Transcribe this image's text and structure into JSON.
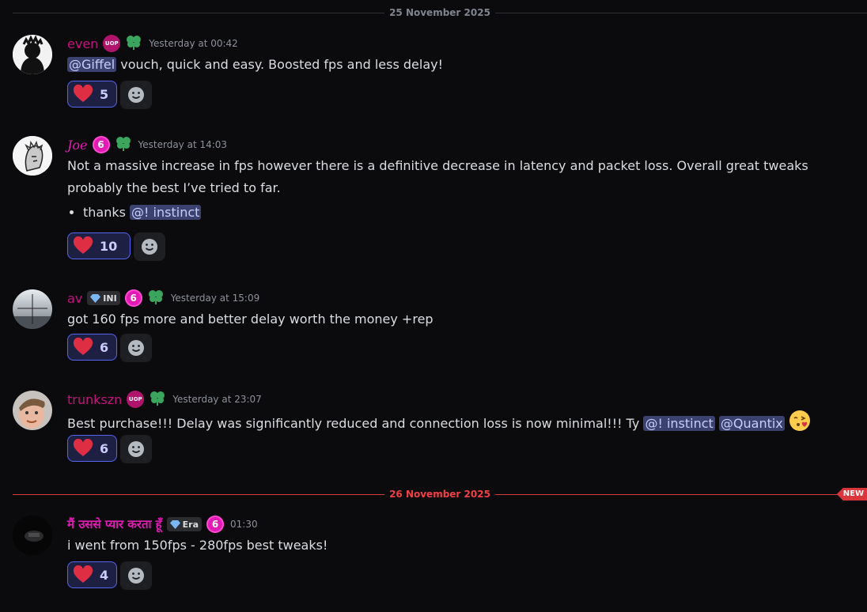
{
  "dividers": {
    "first": "25 November 2025",
    "second": "26 November 2025",
    "new_label": "NEW"
  },
  "colors": {
    "pink_name": "#c2127c",
    "magenta_name": "#e21bb5",
    "mention_bg": "#3c4270",
    "reaction_border": "#5865f2",
    "new_red": "#da373c"
  },
  "messages": [
    {
      "username": "even",
      "timestamp": "Yesterday at 00:42",
      "mention": "@Giffel",
      "text": " vouch, quick and easy. Boosted fps and less delay!",
      "reaction_count": "5"
    },
    {
      "username": "Joe",
      "timestamp": "Yesterday at 14:03",
      "text": "Not a massive increase in fps however there is a definitive decrease in latency and packet loss. Overall great tweaks probably the best I’ve tried to far.",
      "bullet_text": "thanks ",
      "bullet_mention": "@! instinct",
      "reaction_count": "10"
    },
    {
      "username": "av",
      "tag": "INI",
      "timestamp": "Yesterday at 15:09",
      "text": "got 160 fps more and better delay worth the money +rep",
      "reaction_count": "6"
    },
    {
      "username": "trunkszn",
      "timestamp": "Yesterday at 23:07",
      "text": "Best purchase!!! Delay was significantly reduced and connection loss is now minimal!!! Ty ",
      "mention1": "@! instinct",
      "mention2": "@Quantix",
      "reaction_count": "6"
    },
    {
      "username": "मैं उससे प्यार करता हूँ",
      "tag": "Era",
      "timestamp": "01:30",
      "text": "i went from 150fps - 280fps best tweaks!",
      "reaction_count": "4"
    }
  ],
  "badges": {
    "uop": "UOP",
    "six": "6"
  },
  "icons": {
    "reaction": "heart-icon",
    "add_reaction": "smiley-icon",
    "clover": "clover-icon",
    "gem": "gem-icon",
    "emoji_kiss": "face-blowing-kiss-icon"
  }
}
